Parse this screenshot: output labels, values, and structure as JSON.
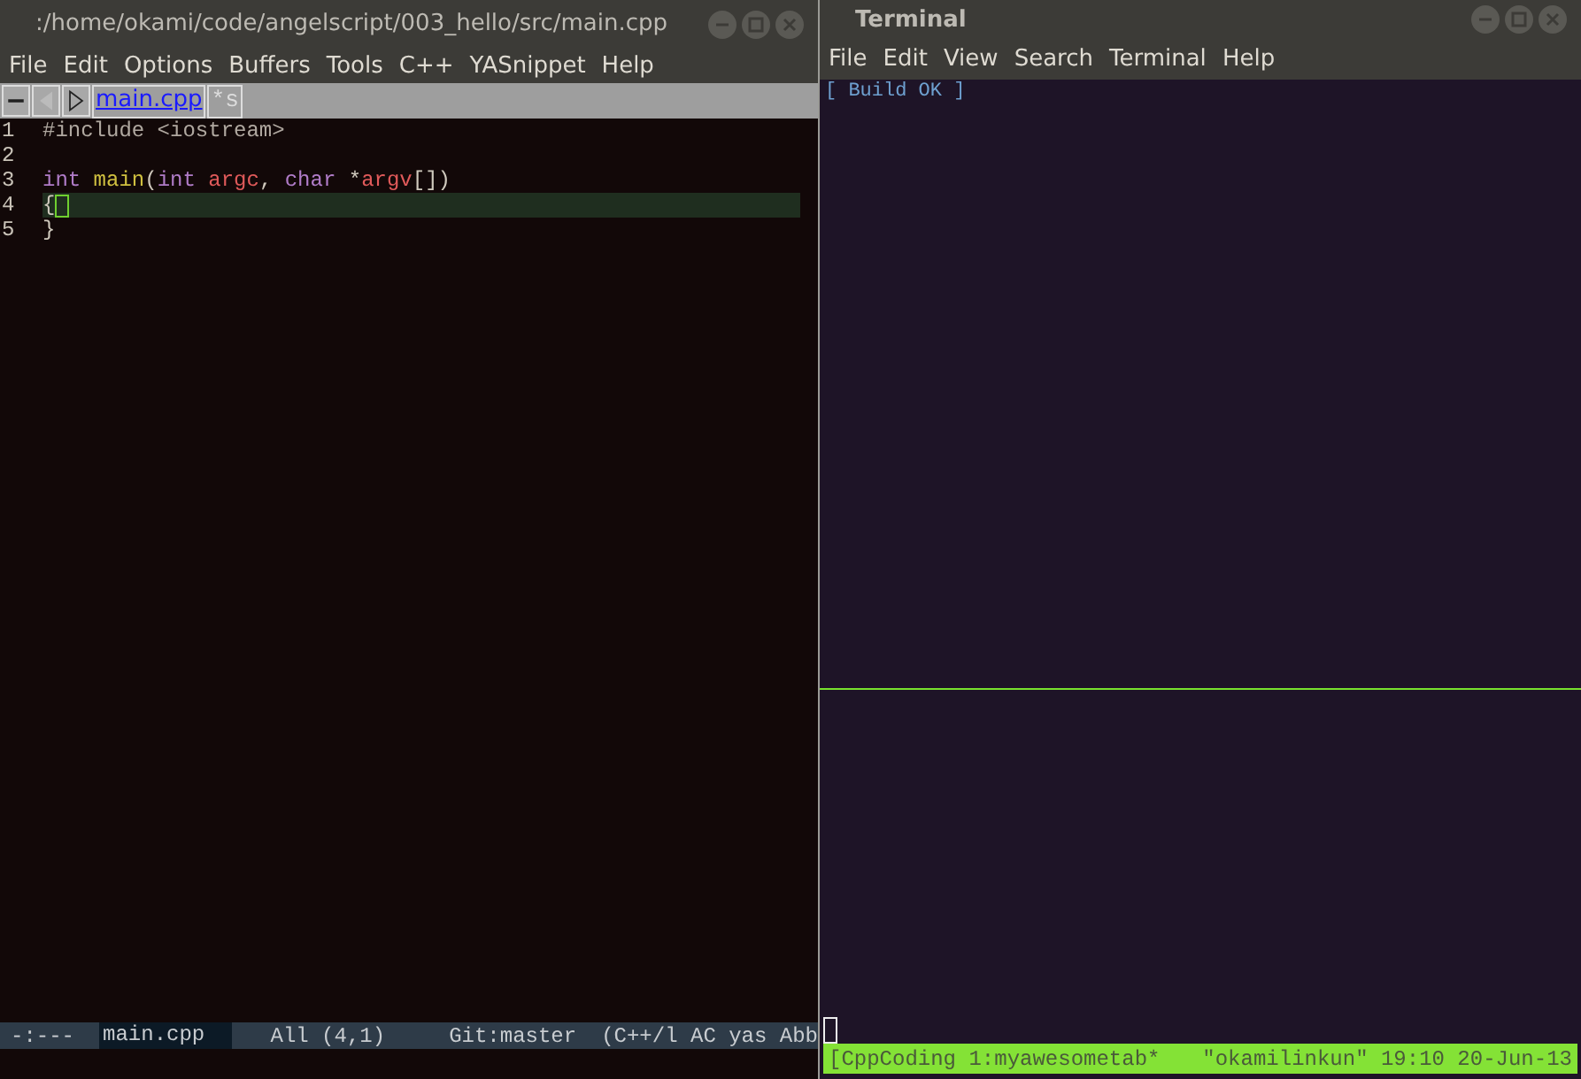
{
  "editor": {
    "title": ":/home/okami/code/angelscript/003_hello/src/main.cpp",
    "menu": [
      "File",
      "Edit",
      "Options",
      "Buffers",
      "Tools",
      "C++",
      "YASnippet",
      "Help"
    ],
    "tabs": [
      {
        "label": "main.cpp",
        "selected": true
      },
      {
        "label": "*s",
        "selected": false
      }
    ],
    "lines": [
      {
        "number": "1",
        "current": false,
        "tokens": [
          {
            "text": "#include <iostream>",
            "kind": "preproc"
          }
        ]
      },
      {
        "number": "2",
        "current": false
      },
      {
        "number": "3",
        "current": false,
        "tokens": [
          {
            "text": "int",
            "kind": "keyword"
          },
          {
            "text": " main",
            "kind": "function"
          },
          {
            "text": "(",
            "kind": "plain"
          },
          {
            "text": "int",
            "kind": "keyword"
          },
          {
            "text": " argc",
            "kind": "variable"
          },
          {
            "text": ", ",
            "kind": "plain"
          },
          {
            "text": "char",
            "kind": "keyword"
          },
          {
            "text": " *",
            "kind": "plain"
          },
          {
            "text": "argv",
            "kind": "variable"
          },
          {
            "text": "[])",
            "kind": "plain"
          }
        ]
      },
      {
        "number": "4",
        "current": true,
        "tokens": [
          {
            "text": "{",
            "kind": "plain"
          }
        ]
      },
      {
        "number": "5",
        "current": false,
        "tokens": [
          {
            "text": "}",
            "kind": "plain"
          }
        ]
      }
    ],
    "modeline": {
      "status": "-:---",
      "buffer": "main.cpp",
      "position": "All (4,1)",
      "vc": "Git:master",
      "modes": "(C++/l AC yas Abb"
    }
  },
  "terminal": {
    "title": "Terminal",
    "menu": [
      "File",
      "Edit",
      "View",
      "Search",
      "Terminal",
      "Help"
    ],
    "output": "[ Build OK ]",
    "status": {
      "left": "[CppCoding 1:myawesometab*",
      "right": "\"okamilinkun\" 19:10 20-Jun-13"
    }
  }
}
